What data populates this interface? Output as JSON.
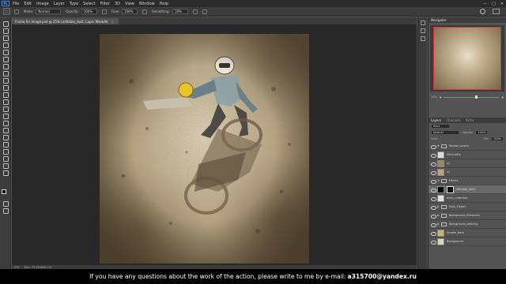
{
  "app": {
    "logo": "Ps"
  },
  "menu": [
    "File",
    "Edit",
    "Image",
    "Layer",
    "Type",
    "Select",
    "Filter",
    "3D",
    "View",
    "Window",
    "Help"
  ],
  "window_controls": [
    "—",
    "□",
    "✕"
  ],
  "options": {
    "mode_label": "Mode:",
    "mode_value": "Normal",
    "opacity_label": "Opacity:",
    "opacity_value": "100%",
    "flow_label": "Flow:",
    "flow_value": "100%",
    "smoothing_label": "Smoothing:",
    "smoothing_value": "10%"
  },
  "document": {
    "tab_title": "Frame for Image.psd @ 25% (editable_dust, Layer Mask/8)",
    "tab_close": "×",
    "status_zoom": "25%",
    "status_doc": "Doc: 75,4M/838,1M"
  },
  "navigator": {
    "tab": "Navigator",
    "zoom": "25%"
  },
  "layers_panel": {
    "tabs": [
      "Layers",
      "Channels",
      "Paths"
    ],
    "kind_label": "Kind",
    "blend_mode": "Normal",
    "opacity_label": "Opacity:",
    "opacity_value": "100%",
    "fill_label": "Fill:",
    "fill_value": "100%",
    "lock_label": "Lock:",
    "layers": [
      {
        "name": "Smoke_screen",
        "type": "group"
      },
      {
        "name": "Silhouette",
        "type": "layer",
        "thumb": "#dcdcdc"
      },
      {
        "name": "s2",
        "type": "layer",
        "thumb": "#9b8764"
      },
      {
        "name": "s1",
        "type": "layer",
        "thumb": "#b9a57e"
      },
      {
        "name": "Effects",
        "type": "group"
      },
      {
        "name": "editable_dust",
        "type": "mask",
        "thumb": "#000000",
        "selected": true
      },
      {
        "name": "dust_underfast",
        "type": "layer",
        "thumb": "#e4e0d6"
      },
      {
        "name": "Main_Object",
        "type": "group"
      },
      {
        "name": "Background_Elements",
        "type": "group"
      },
      {
        "name": "Background_coloring",
        "type": "group"
      },
      {
        "name": "Smoke_Back",
        "type": "layer",
        "thumb": "#c9b27a"
      },
      {
        "name": "Background",
        "type": "layer",
        "thumb": "#d8d2c2"
      }
    ]
  },
  "subtitle": {
    "text": "If you have any questions about the work of the action, please write to me by e-mail:",
    "email": "a315700@yandex.ru"
  }
}
